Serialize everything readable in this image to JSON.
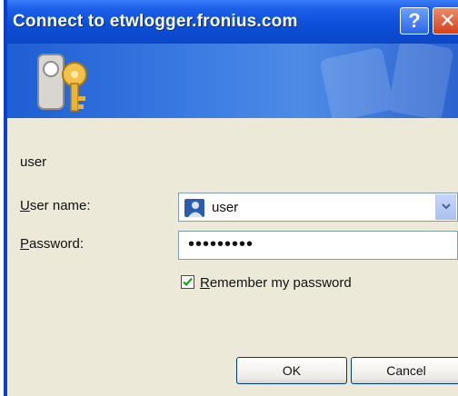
{
  "window": {
    "title": "Connect to etwlogger.fronius.com",
    "help_glyph": "?",
    "close_glyph": "✕"
  },
  "icons": {
    "banner": "keys-icon",
    "user": "user-account-icon",
    "dropdown": "chevron-down-icon",
    "check": "checkmark-icon"
  },
  "realm_text": "user",
  "form": {
    "username_label_accel": "U",
    "username_label_rest": "ser name:",
    "username_value": "user",
    "password_label_accel": "P",
    "password_label_rest": "assword:",
    "password_value": "•••••••••",
    "remember_checked": true,
    "remember_label_accel": "R",
    "remember_label_rest": "emember my password"
  },
  "buttons": {
    "ok": "OK",
    "cancel": "Cancel"
  },
  "colors": {
    "titlebar": "#0d4fd8",
    "banner": "#3a7ae2",
    "dialog_bg": "#ece9d8",
    "field_border": "#7f9db9"
  }
}
